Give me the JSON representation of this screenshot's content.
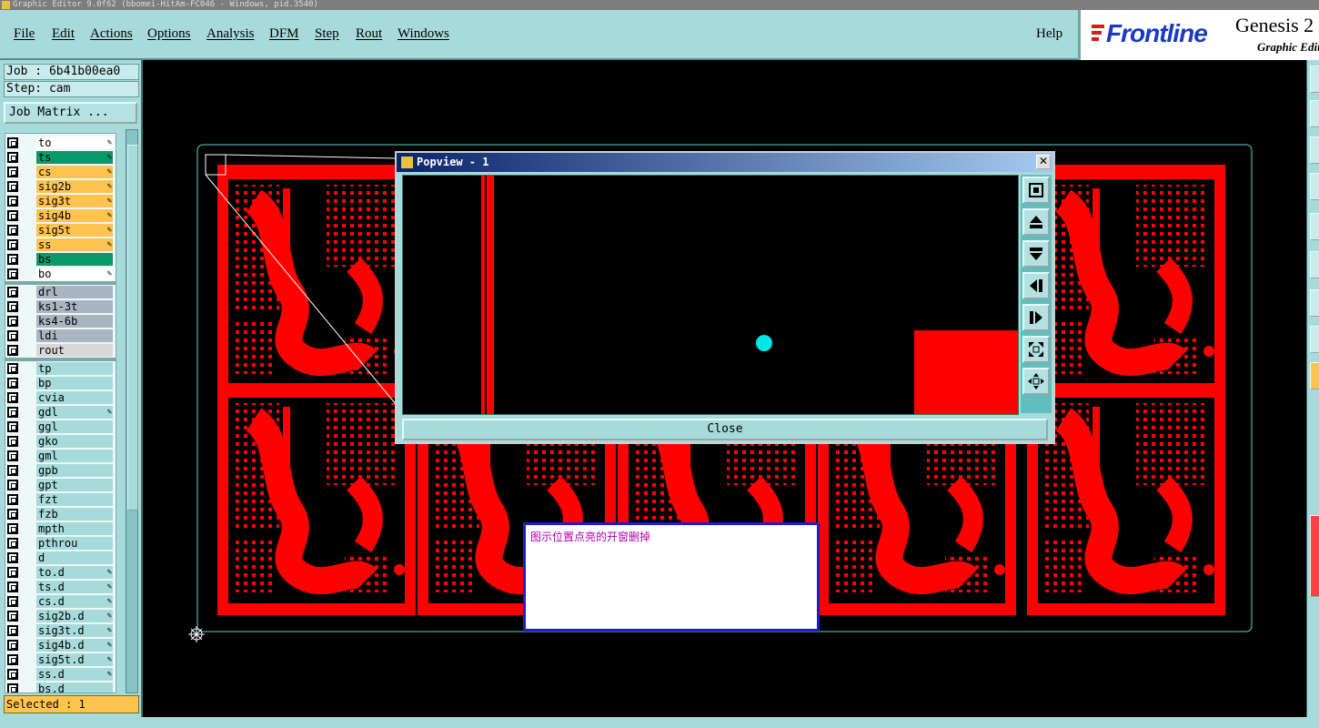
{
  "title_bar": "Graphic Editor 9.0f62 (bbomei-HitAm-FC046 - Windows, pid.3540)",
  "menu": {
    "items": [
      "File",
      "Edit",
      "Actions",
      "Options",
      "Analysis",
      "DFM",
      "Step",
      "Rout",
      "Windows"
    ],
    "help": "Help"
  },
  "logo": {
    "brand": "Frontline",
    "product": "Genesis 2",
    "subtitle": "Graphic Editor"
  },
  "job": {
    "job_line": "Job : 6b41b00ea0",
    "step_line": "Step: cam",
    "matrix_button": "Job Matrix ..."
  },
  "layers": {
    "group1": [
      {
        "name": "to",
        "color": "#ffffff",
        "mark": "✎"
      },
      {
        "name": "ts",
        "color": "#0a9a6a",
        "mark": "✎"
      },
      {
        "name": "cs",
        "color": "#ffc44f",
        "mark": "✎"
      },
      {
        "name": "sig2b",
        "color": "#ffc44f",
        "mark": "✎"
      },
      {
        "name": "sig3t",
        "color": "#ffc44f",
        "mark": "✎"
      },
      {
        "name": "sig4b",
        "color": "#ffc44f",
        "mark": "✎"
      },
      {
        "name": "sig5t",
        "color": "#ffc44f",
        "mark": "✎"
      },
      {
        "name": "ss",
        "color": "#ffc44f",
        "mark": "✎"
      },
      {
        "name": "bs",
        "color": "#0a9a6a",
        "mark": ""
      },
      {
        "name": "bo",
        "color": "#ffffff",
        "mark": "✎"
      }
    ],
    "group2": [
      {
        "name": "drl",
        "color": "#a9b6c2",
        "mark": ""
      },
      {
        "name": "ks1-3t",
        "color": "#a9b6c2",
        "mark": ""
      },
      {
        "name": "ks4-6b",
        "color": "#a9b6c2",
        "mark": ""
      },
      {
        "name": "ldi",
        "color": "#a9b6c2",
        "mark": ""
      },
      {
        "name": "rout",
        "color": "#d8d8d8",
        "mark": ""
      }
    ],
    "group3": [
      {
        "name": "tp",
        "color": "#a7dbdb",
        "mark": ""
      },
      {
        "name": "bp",
        "color": "#a7dbdb",
        "mark": ""
      },
      {
        "name": "cvia",
        "color": "#a7dbdb",
        "mark": ""
      },
      {
        "name": "gdl",
        "color": "#a7dbdb",
        "mark": "✎"
      },
      {
        "name": "ggl",
        "color": "#a7dbdb",
        "mark": ""
      },
      {
        "name": "gko",
        "color": "#a7dbdb",
        "mark": ""
      },
      {
        "name": "gml",
        "color": "#a7dbdb",
        "mark": ""
      },
      {
        "name": "gpb",
        "color": "#a7dbdb",
        "mark": ""
      },
      {
        "name": "gpt",
        "color": "#a7dbdb",
        "mark": ""
      },
      {
        "name": "fzt",
        "color": "#a7dbdb",
        "mark": ""
      },
      {
        "name": "fzb",
        "color": "#a7dbdb",
        "mark": ""
      },
      {
        "name": "mpth",
        "color": "#a7dbdb",
        "mark": ""
      },
      {
        "name": "pthrou",
        "color": "#a7dbdb",
        "mark": ""
      },
      {
        "name": "d",
        "color": "#a7dbdb",
        "mark": ""
      },
      {
        "name": "to.d",
        "color": "#a7dbdb",
        "mark": "✎"
      },
      {
        "name": "ts.d",
        "color": "#a7dbdb",
        "mark": "✎"
      },
      {
        "name": "cs.d",
        "color": "#a7dbdb",
        "mark": "✎"
      },
      {
        "name": "sig2b.d",
        "color": "#a7dbdb",
        "mark": "✎"
      },
      {
        "name": "sig3t.d",
        "color": "#a7dbdb",
        "mark": "✎"
      },
      {
        "name": "sig4b.d",
        "color": "#a7dbdb",
        "mark": "✎"
      },
      {
        "name": "sig5t.d",
        "color": "#a7dbdb",
        "mark": "✎"
      },
      {
        "name": "ss.d",
        "color": "#a7dbdb",
        "mark": "✎"
      },
      {
        "name": "bs.d",
        "color": "#a7dbdb",
        "mark": ""
      }
    ]
  },
  "status": {
    "selected": "Selected : 1"
  },
  "popview": {
    "title": "Popview - 1",
    "close_x": "✕",
    "close_button": "Close",
    "tools": [
      "zoom-fit-icon",
      "pan-up-icon",
      "pan-down-icon",
      "pan-left-icon",
      "pan-right-icon",
      "zoom-out-icon",
      "zoom-in-icon"
    ]
  },
  "note": {
    "text": "图示位置点亮的开窗删掉"
  },
  "colors": {
    "panel": "#a7dbdb",
    "copper": "#ff0000",
    "outline": "#5fd0d0",
    "highlight": "#00e5e5",
    "selected_bg": "#ffc44f",
    "note_border": "#1d1dd0",
    "note_text": "#b000b0"
  }
}
